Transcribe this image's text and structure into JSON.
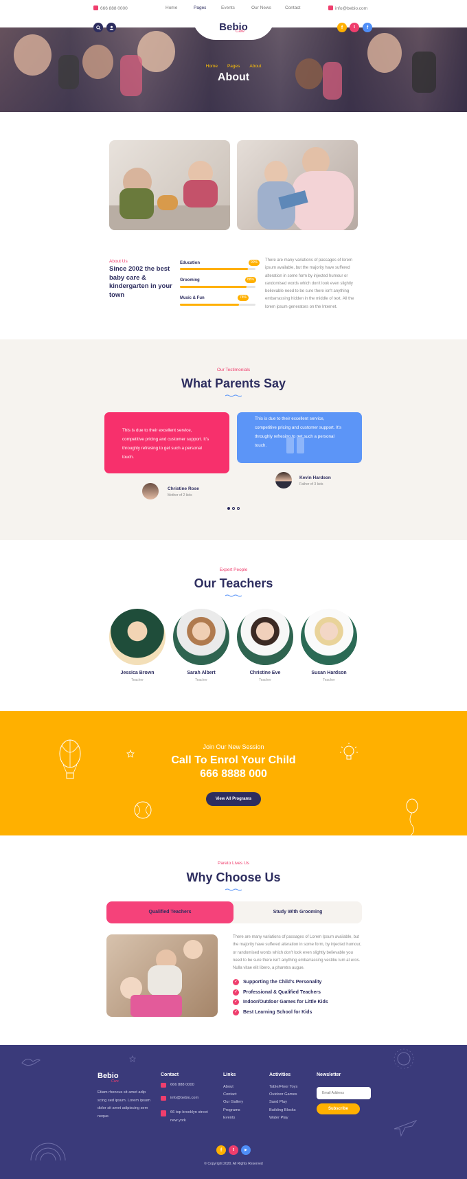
{
  "topbar": {
    "phone": "666 888 0000",
    "nav": [
      "Home",
      "Pages",
      "Events",
      "Our News",
      "Contact"
    ],
    "email": "info@bebio.com"
  },
  "brand": {
    "logo": "Bebio",
    "logo_sub": "Care"
  },
  "hero": {
    "breadcrumb": [
      "Home",
      "Pages",
      "About"
    ],
    "title": "About"
  },
  "about": {
    "tag": "About Us",
    "heading": "Since 2002 the best baby care & kindergarten in your town",
    "skills": [
      {
        "label": "Education",
        "percent": 90,
        "percent_label": "90%"
      },
      {
        "label": "Grooming",
        "percent": 88,
        "percent_label": "88%"
      },
      {
        "label": "Music & Fun",
        "percent": 78,
        "percent_label": "78%"
      }
    ],
    "text": "There are many variations of passages of lorem ipsum available, but the majority have suffered alteration in some form by injected humour or randomised words which don't look even slightly believable need to be sure there isn't anything embarrassing hidden in the middle of text. All the lorem ipsum generators on the Internet."
  },
  "testimonials": {
    "tag": "Our Testimonials",
    "title": "What Parents Say",
    "items": [
      {
        "text": "This is due to their excellent service, competitive pricing and customer support. It's throughly refresing to get such a personal touch.",
        "name": "Christine Rose",
        "role": "Mother of 2 kids"
      },
      {
        "text": "This is due to their excellent service, competitive pricing and customer support. It's throughly refresing to get such a personal touch.",
        "name": "Kevin Hardson",
        "role": "Father of 3 kids"
      }
    ]
  },
  "teachers": {
    "tag": "Expert People",
    "title": "Our Teachers",
    "items": [
      {
        "name": "Jessica Brown",
        "role": "Teacher"
      },
      {
        "name": "Sarah Albert",
        "role": "Teacher"
      },
      {
        "name": "Christine Eve",
        "role": "Teacher"
      },
      {
        "name": "Susan Hardson",
        "role": "Teacher"
      }
    ]
  },
  "enrol": {
    "tag": "Join Our New Session",
    "title": "Call To Enrol Your Child",
    "phone": "666 8888 000",
    "button": "View All Programs"
  },
  "why": {
    "tag": "Pareto Lives Us",
    "title": "Why Choose Us",
    "tabs": [
      "Qualified Teachers",
      "Study With Grooming"
    ],
    "text": "There are many variations of passages of Lorem Ipsum available, but the majority have suffered alteration in some form, by injected humour, or randomised words which don't look even slightly believable you need to be sure there isn't anything embarrassing vestibu lum at eros. Nulla vitae elit libero, a pharetra augue.",
    "points": [
      "Supporting the Child's Personality",
      "Professional & Qualified Teachers",
      "Indoor/Outdoor Games for Little Kids",
      "Best Learning School for Kids"
    ]
  },
  "footer": {
    "about": "Etiam rhoncus sit amet adip scing sed ipsum. Lorem ipsum dolor sit amet adipiscing sem neque.",
    "contact_title": "Contact",
    "contact": [
      "666 888 0000",
      "info@bebio.com",
      "66 top brooklyn street new york"
    ],
    "links_title": "Links",
    "links": [
      "About",
      "Contact",
      "Our Gallery",
      "Programs",
      "Events"
    ],
    "activities_title": "Activities",
    "activities": [
      "Table/Floor Toys",
      "Outdoor Games",
      "Sand Play",
      "Building Blocks",
      "Water Play"
    ],
    "newsletter_title": "Newsletter",
    "email_placeholder": "Email Address",
    "subscribe": "Subscribe",
    "copyright": "© Copyright 2020. All Rights Reserved"
  }
}
